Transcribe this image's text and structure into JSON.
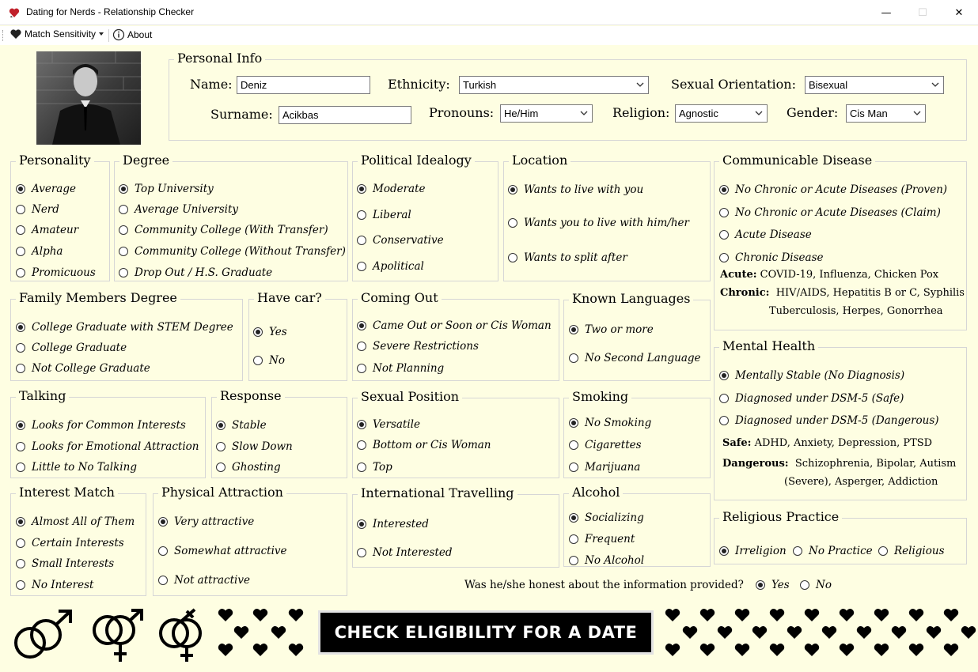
{
  "window": {
    "title": "Dating for Nerds - Relationship Checker",
    "minimize": "—",
    "maximize": "☐",
    "close": "✕"
  },
  "menu": {
    "match_sensitivity": "Match Sensitivity",
    "about": "About"
  },
  "personal_info": {
    "title": "Personal Info",
    "name_label": "Name:",
    "name_value": "Deniz",
    "surname_label": "Surname:",
    "surname_value": "Acikbas",
    "ethnicity_label": "Ethnicity:",
    "ethnicity_value": "Turkish",
    "pronouns_label": "Pronouns:",
    "pronouns_value": "He/Him",
    "orientation_label": "Sexual Orientation:",
    "orientation_value": "Bisexual",
    "religion_label": "Religion:",
    "religion_value": "Agnostic",
    "gender_label": "Gender:",
    "gender_value": "Cis Man"
  },
  "groups": {
    "personality": {
      "title": "Personality",
      "options": [
        "Average",
        "Nerd",
        "Amateur",
        "Alpha",
        "Promicuous"
      ],
      "selected": 0
    },
    "degree": {
      "title": "Degree",
      "options": [
        "Top University",
        "Average University",
        "Community College (With Transfer)",
        "Community College (Without Transfer)",
        "Drop Out / H.S. Graduate"
      ],
      "selected": 0
    },
    "political": {
      "title": "Political Idealogy",
      "options": [
        "Moderate",
        "Liberal",
        "Conservative",
        "Apolitical"
      ],
      "selected": 0
    },
    "location": {
      "title": "Location",
      "options": [
        "Wants to live with you",
        "Wants you to live with him/her",
        "Wants to split after"
      ],
      "selected": 0
    },
    "disease": {
      "title": "Communicable Disease",
      "options": [
        "No Chronic or Acute Diseases (Proven)",
        "No Chronic or Acute Diseases (Claim)",
        "Acute Disease",
        "Chronic Disease"
      ],
      "selected": 0,
      "acute_label": "Acute:",
      "acute_text": "COVID-19, Influenza, Chicken Pox",
      "chronic_label": "Chronic:",
      "chronic_text1": "HIV/AIDS, Hepatitis B or C, Syphilis",
      "chronic_text2": "Tuberculosis, Herpes, Gonorrhea"
    },
    "family": {
      "title": "Family Members Degree",
      "options": [
        "College Graduate with STEM Degree",
        "College Graduate",
        "Not College Graduate"
      ],
      "selected": 0
    },
    "car": {
      "title": "Have car?",
      "options": [
        "Yes",
        "No"
      ],
      "selected": 0
    },
    "coming_out": {
      "title": "Coming Out",
      "options": [
        "Came Out or Soon or Cis Woman",
        "Severe Restrictions",
        "Not Planning"
      ],
      "selected": 0
    },
    "languages": {
      "title": "Known Languages",
      "options": [
        "Two or more",
        "No Second Language"
      ],
      "selected": 0
    },
    "mental": {
      "title": "Mental Health",
      "options": [
        "Mentally Stable (No Diagnosis)",
        "Diagnosed under DSM-5 (Safe)",
        "Diagnosed under DSM-5 (Dangerous)"
      ],
      "selected": 0,
      "safe_label": "Safe:",
      "safe_text": "ADHD, Anxiety, Depression, PTSD",
      "dangerous_label": "Dangerous:",
      "dangerous_text1": "Schizophrenia, Bipolar, Autism",
      "dangerous_text2": "(Severe), Asperger, Addiction"
    },
    "talking": {
      "title": "Talking",
      "options": [
        "Looks for Common Interests",
        "Looks for Emotional Attraction",
        "Little to No Talking"
      ],
      "selected": 0
    },
    "response": {
      "title": "Response",
      "options": [
        "Stable",
        "Slow Down",
        "Ghosting"
      ],
      "selected": 0
    },
    "position": {
      "title": "Sexual Position",
      "options": [
        "Versatile",
        "Bottom or Cis Woman",
        "Top"
      ],
      "selected": 0
    },
    "smoking": {
      "title": "Smoking",
      "options": [
        "No Smoking",
        "Cigarettes",
        "Marijuana"
      ],
      "selected": 0
    },
    "interest": {
      "title": "Interest Match",
      "options": [
        "Almost All of Them",
        "Certain Interests",
        "Small Interests",
        "No Interest"
      ],
      "selected": 0
    },
    "physical": {
      "title": "Physical Attraction",
      "options": [
        "Very attractive",
        "Somewhat attractive",
        "Not attractive"
      ],
      "selected": 0
    },
    "travel": {
      "title": "International Travelling",
      "options": [
        "Interested",
        "Not Interested"
      ],
      "selected": 0
    },
    "alcohol": {
      "title": "Alcohol",
      "options": [
        "Socializing",
        "Frequent",
        "No Alcohol"
      ],
      "selected": 0
    },
    "religious": {
      "title": "Religious Practice",
      "options": [
        "Irreligion",
        "No Practice",
        "Religious"
      ],
      "selected": 0
    }
  },
  "honesty": {
    "question": "Was he/she honest about the information provided?",
    "options": [
      "Yes",
      "No"
    ],
    "selected": 0
  },
  "check_button": "CHECK ELIGIBILITY FOR A DATE",
  "decor": {
    "symbols": [
      "male-female-icon",
      "intersex-icon",
      "transgender-icon"
    ],
    "heart_color": "#000000"
  }
}
